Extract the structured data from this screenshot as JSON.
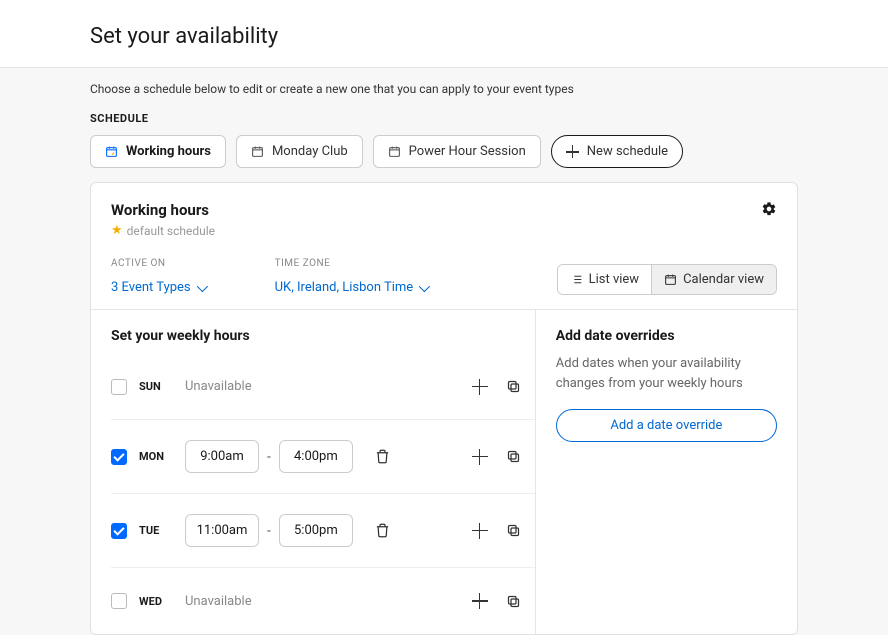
{
  "header": {
    "title": "Set your availability"
  },
  "intro": "Choose a schedule below to edit or create a new one that you can apply to your event types",
  "schedule_label": "SCHEDULE",
  "schedule_tabs": [
    {
      "label": "Working hours",
      "active": true
    },
    {
      "label": "Monday Club",
      "active": false
    },
    {
      "label": "Power Hour Session",
      "active": false
    }
  ],
  "new_schedule_label": "New schedule",
  "card": {
    "title": "Working hours",
    "default_label": "default schedule",
    "active_on_label": "ACTIVE ON",
    "active_on_value": "3 Event Types",
    "timezone_label": "TIME ZONE",
    "timezone_value": "UK, Ireland, Lisbon Time",
    "view_list": "List view",
    "view_cal": "Calendar view"
  },
  "weekly": {
    "title": "Set your weekly hours",
    "days": [
      {
        "key": "sun",
        "label": "SUN",
        "checked": false,
        "unavailable": "Unavailable"
      },
      {
        "key": "mon",
        "label": "MON",
        "checked": true,
        "start": "9:00am",
        "end": "4:00pm"
      },
      {
        "key": "tue",
        "label": "TUE",
        "checked": true,
        "start": "11:00am",
        "end": "5:00pm"
      },
      {
        "key": "wed",
        "label": "WED",
        "checked": false,
        "unavailable": "Unavailable"
      }
    ]
  },
  "overrides": {
    "title": "Add date overrides",
    "desc": "Add dates when your availability changes from your weekly hours",
    "button": "Add a date override"
  }
}
